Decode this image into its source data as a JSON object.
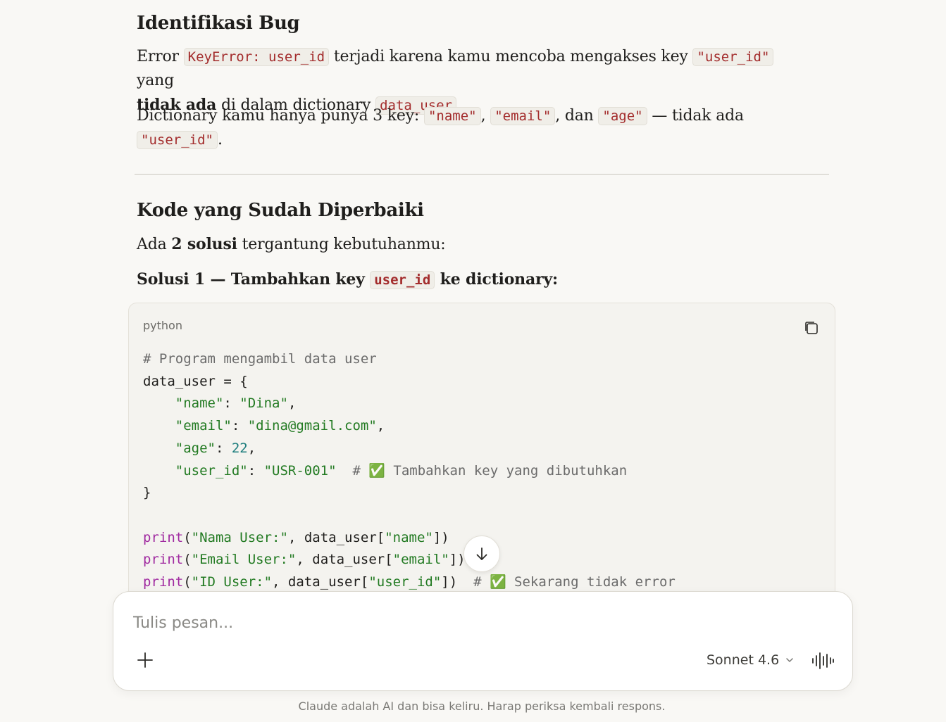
{
  "section1": {
    "heading": "Identifikasi Bug",
    "p1": {
      "t1": "Error ",
      "code1": "KeyError: user_id",
      "t2": " terjadi karena kamu mencoba mengakses key ",
      "code2": "\"user_id\"",
      "t3": " yang",
      "bold1": "tidak ada",
      "t4": " di dalam dictionary ",
      "code3": "data_user",
      "t5": "."
    },
    "p2": {
      "t1": "Dictionary kamu hanya punya 3 key: ",
      "code1": "\"name\"",
      "t2": ", ",
      "code2": "\"email\"",
      "t3": ", dan ",
      "code3": "\"age\"",
      "t4": " — tidak ada",
      "code4": "\"user_id\"",
      "t5": "."
    }
  },
  "section2": {
    "heading": "Kode yang Sudah Diperbaiki",
    "p1": {
      "t1": "Ada ",
      "bold1": "2 solusi",
      "t2": " tergantung kebutuhanmu:"
    },
    "solution1": {
      "t1": "Solusi 1 — Tambahkan key ",
      "code1": "user_id",
      "t2": " ke dictionary:"
    }
  },
  "code_block": {
    "language": "python",
    "copy_icon": "copy-icon",
    "lines": {
      "l1": "# Program mengambil data user",
      "l2_a": "data_user = {",
      "l3_key": "\"name\"",
      "l3_sep": ": ",
      "l3_val": "\"Dina\"",
      "l3_end": ",",
      "l4_key": "\"email\"",
      "l4_sep": ": ",
      "l4_val": "\"dina@gmail.com\"",
      "l4_end": ",",
      "l5_key": "\"age\"",
      "l5_sep": ": ",
      "l5_val": "22",
      "l5_end": ",",
      "l6_key": "\"user_id\"",
      "l6_sep": ": ",
      "l6_val": "\"USR-001\"",
      "l6_comment": "# ✅ Tambahkan key yang dibutuhkan",
      "l7": "}",
      "l9_fn": "print",
      "l9_a": "(",
      "l9_s": "\"Nama User:\"",
      "l9_b": ", data_user[",
      "l9_k": "\"name\"",
      "l9_c": "])",
      "l10_fn": "print",
      "l10_a": "(",
      "l10_s": "\"Email User:\"",
      "l10_b": ", data_user[",
      "l10_k": "\"email\"",
      "l10_c": "])",
      "l11_fn": "print",
      "l11_a": "(",
      "l11_s": "\"ID User:\"",
      "l11_b": ", data_user[",
      "l11_k": "\"user_id\"",
      "l11_c": "])",
      "l11_comment": "# ✅ Sekarang tidak error"
    }
  },
  "composer": {
    "placeholder": "Tulis pesan...",
    "value": "",
    "model": "Sonnet 4.6",
    "plus_icon": "plus-icon",
    "voice_icon": "voice-icon"
  },
  "disclaimer": "Claude adalah AI dan bisa keliru. Harap periksa kembali respons.",
  "colors": {
    "background": "#f9f8f5",
    "inline_code_text": "#a32c2c",
    "code_string": "#227a22",
    "code_number": "#1d7d7d",
    "code_keyword": "#a02aa0",
    "code_comment": "#6b6b6b"
  }
}
